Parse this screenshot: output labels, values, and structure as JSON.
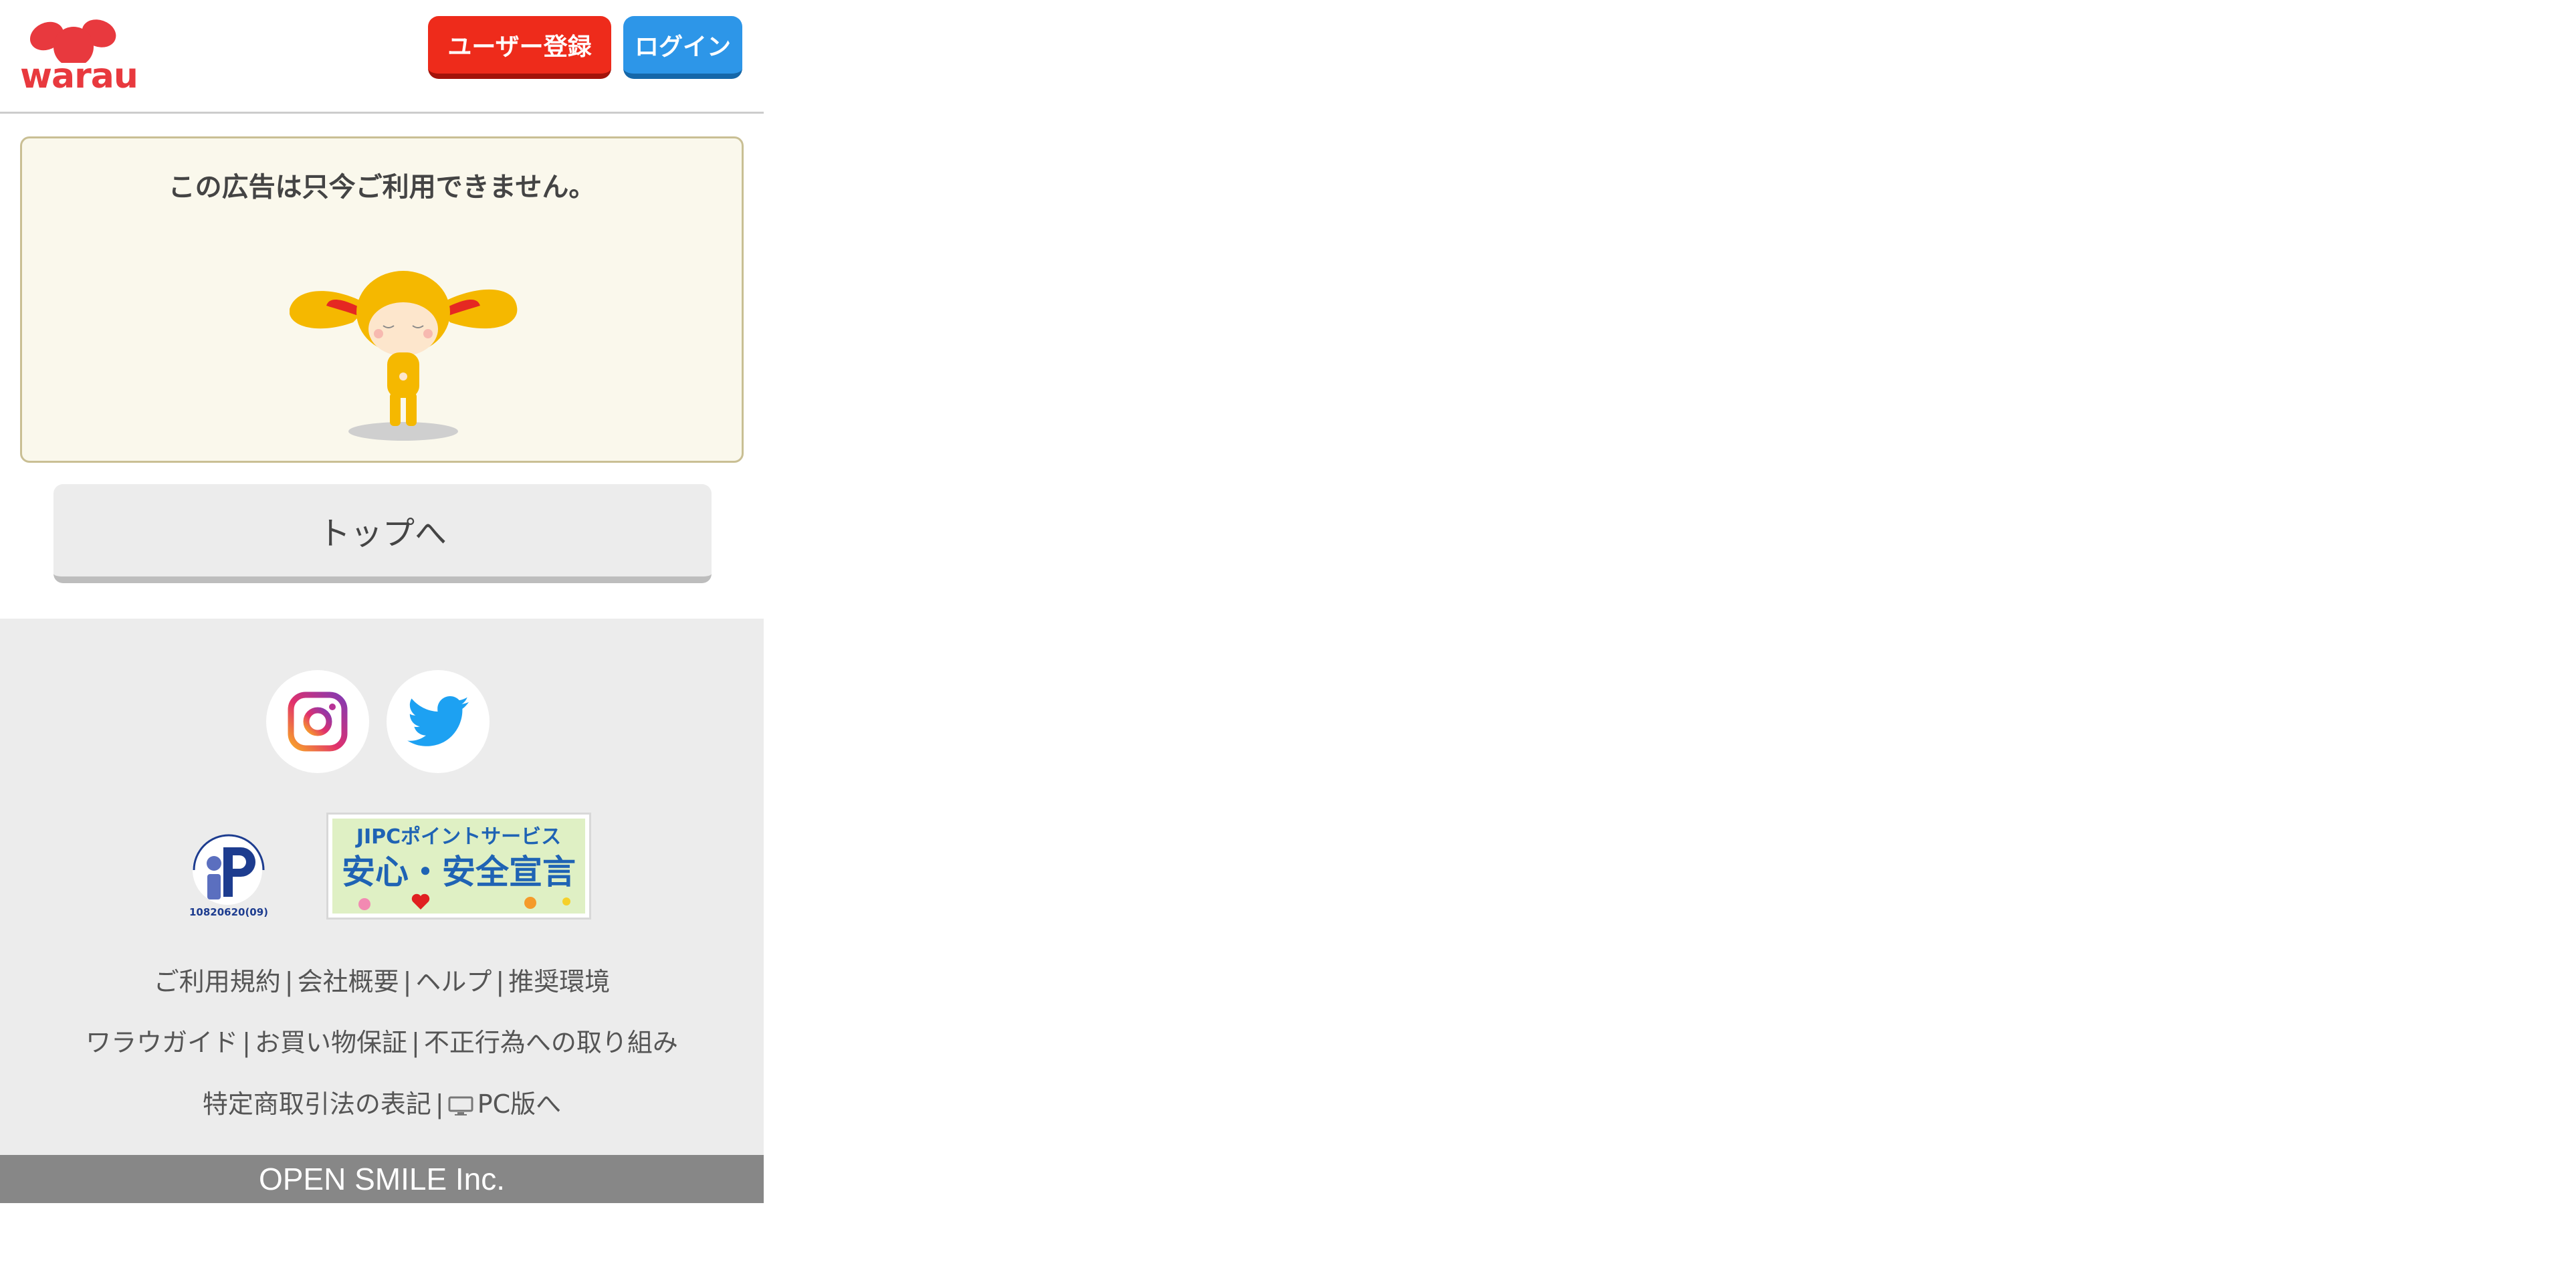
{
  "header": {
    "logo_text": "warau",
    "register_label": "ユーザー登録",
    "login_label": "ログイン"
  },
  "notice": {
    "message": "この広告は只今ご利用できません。"
  },
  "top_button_label": "トップへ",
  "footer": {
    "social": [
      "instagram-icon",
      "twitter-icon"
    ],
    "privacy_mark_caption": "10820620(09)",
    "privacy_mark_arc": "たいせつにしますプライバシー",
    "jipc_line1": "JIPCポイントサービス",
    "jipc_line2": "安心・安全宣言",
    "links_row1": [
      "ご利用規約",
      "会社概要",
      "ヘルプ",
      "推奨環境"
    ],
    "links_row2": [
      "ワラウガイド",
      "お買い物保証",
      "不正行為への取り組み"
    ],
    "links_row3": [
      "特定商取引法の表記",
      "PC版へ"
    ],
    "separator": "|"
  },
  "copyright": "OPEN SMILE Inc.",
  "colors": {
    "brand_red": "#e8393e",
    "register_button": "#ee2b1b",
    "login_button": "#2d96e8",
    "footer_bg": "#ececec",
    "copyright_bg": "#878787"
  }
}
